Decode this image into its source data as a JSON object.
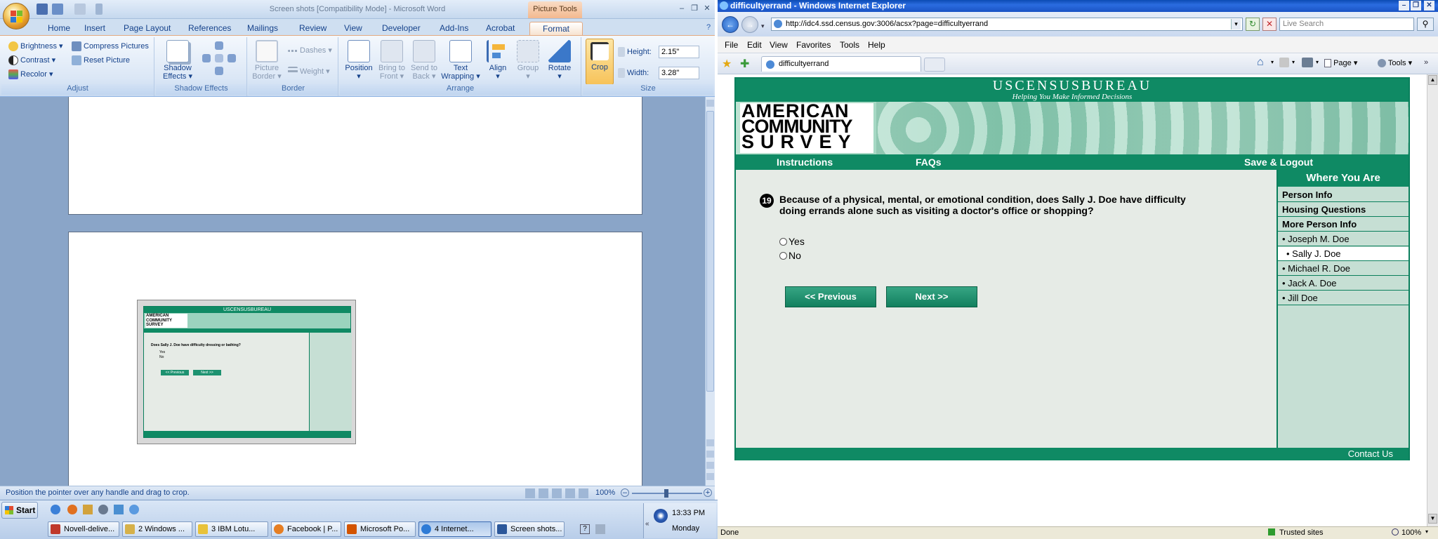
{
  "word": {
    "window_title": "Screen shots [Compatibility Mode] - Microsoft Word",
    "picture_tools": "Picture Tools",
    "tabs": [
      "Home",
      "Insert",
      "Page Layout",
      "References",
      "Mailings",
      "Review",
      "View",
      "Developer",
      "Add-Ins",
      "Acrobat",
      "Format"
    ],
    "active_tab": "Format",
    "groups": {
      "adjust": {
        "label": "Adjust",
        "brightness": "Brightness",
        "contrast": "Contrast",
        "recolor": "Recolor",
        "compress": "Compress Pictures",
        "reset": "Reset Picture"
      },
      "shadow": {
        "label": "Shadow Effects",
        "shadow_effects": "Shadow Effects"
      },
      "border": {
        "label": "Border",
        "picture_border": "Picture Border",
        "dashes": "Dashes",
        "weight": "Weight"
      },
      "arrange": {
        "label": "Arrange",
        "position": "Position",
        "bring_to_front": "Bring to Front",
        "send_to_back": "Send to Back",
        "text_wrapping": "Text Wrapping",
        "align": "Align",
        "group": "Group",
        "rotate": "Rotate"
      },
      "size": {
        "label": "Size",
        "crop": "Crop",
        "height_label": "Height:",
        "height_value": "2.15\"",
        "width_label": "Width:",
        "width_value": "3.28\""
      }
    },
    "status_text": "Position the pointer over any handle and drag to crop.",
    "zoom": "100%",
    "thumbnail": {
      "banner": "USCENSUSBUREAU",
      "logo_lines": [
        "AMERICAN",
        "COMMUNITY",
        "SURVEY"
      ],
      "question": "Does Sally J. Doe have difficulty dressing or bathing?",
      "options": [
        "Yes",
        "No"
      ],
      "prev": "<<   Previous",
      "next": "Next   >>"
    }
  },
  "ie": {
    "window_title": "difficultyerrand - Windows Internet Explorer",
    "address": "http://idc4.ssd.census.gov:3006/acsx?page=difficultyerrand",
    "search_placeholder": "Live Search",
    "menu": [
      "File",
      "Edit",
      "View",
      "Favorites",
      "Tools",
      "Help"
    ],
    "tab_title": "difficultyerrand",
    "cmd": {
      "page": "Page",
      "tools": "Tools"
    },
    "status_left": "Done",
    "status_zone": "Trusted sites",
    "status_zoom": "100%"
  },
  "acs": {
    "banner_title": "USCENSUSBUREAU",
    "banner_tagline": "Helping You Make Informed Decisions",
    "logo_lines": [
      "AMERICAN",
      "COMMUNITY",
      "SURVEY"
    ],
    "nav": {
      "instructions": "Instructions",
      "faqs": "FAQs",
      "save_logout": "Save & Logout"
    },
    "question_number": "19",
    "question_text_line1": "Because of a physical, mental, or emotional condition, does Sally J. Doe have difficulty",
    "question_text_line2": "doing errands alone such as visiting a doctor's office or shopping?",
    "options": [
      "Yes",
      "No"
    ],
    "prev_button": "<<   Previous",
    "next_button": "Next   >>",
    "sidebar": {
      "title": "Where You Are",
      "sections": [
        "Person Info",
        "Housing Questions",
        "More Person Info"
      ],
      "people": [
        "• Joseph M. Doe",
        "• Sally J. Doe",
        "• Michael R. Doe",
        "• Jack A. Doe",
        "• Jill Doe"
      ],
      "selected_person": "• Sally J. Doe"
    },
    "footer": "Contact Us"
  },
  "taskbar": {
    "start": "Start",
    "buttons": [
      "Novell-delive...",
      "2 Windows ...",
      "3 IBM Lotu...",
      "Facebook | P...",
      "Microsoft Po...",
      "4 Internet...",
      "Screen shots..."
    ],
    "active_index": 5,
    "clock_time": "13:33 PM",
    "clock_day": "Monday"
  }
}
